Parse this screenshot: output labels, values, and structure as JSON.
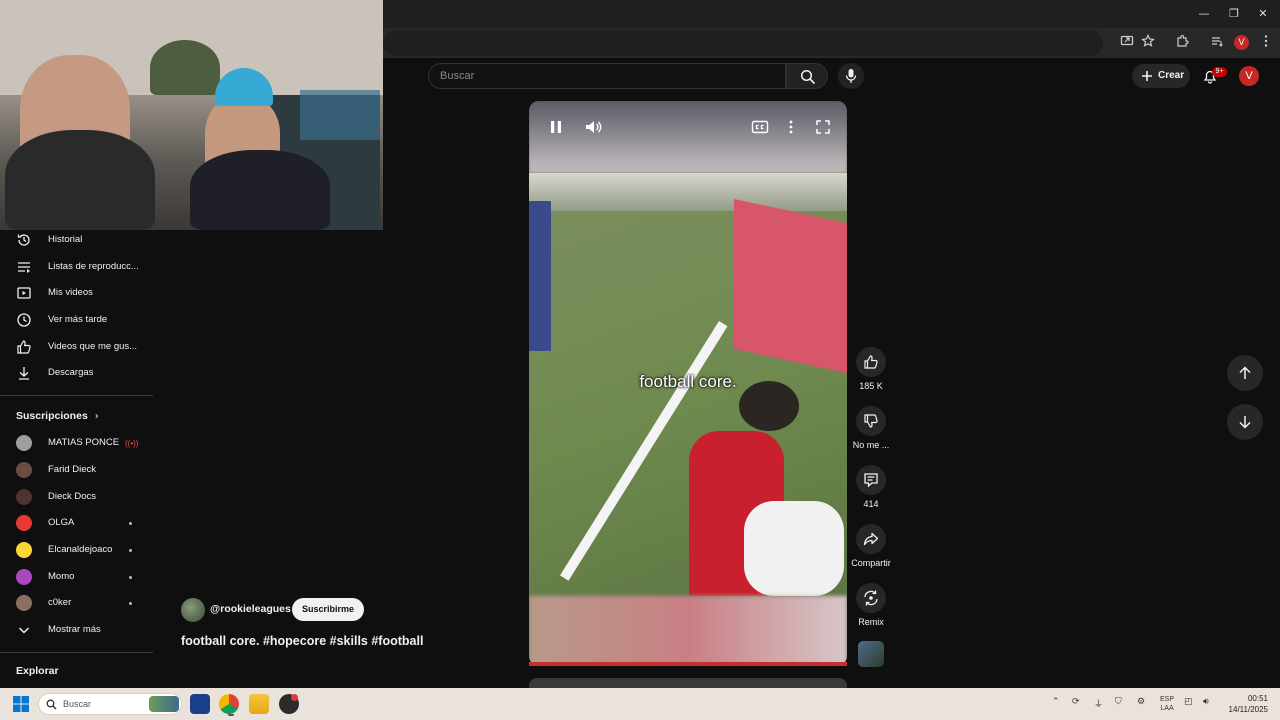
{
  "browser": {
    "window_controls": {
      "minimize": "—",
      "restore": "❐",
      "close": "✕"
    },
    "profile_initial": "V"
  },
  "header": {
    "search_placeholder": "Buscar",
    "create_label": "Crear",
    "notification_count": "9+",
    "avatar_initial": "V"
  },
  "sidebar": {
    "you_items": [
      {
        "label": "Historial",
        "icon": "history-icon"
      },
      {
        "label": "Listas de reproducc...",
        "icon": "playlist-icon"
      },
      {
        "label": "Mis videos",
        "icon": "my-videos-icon"
      },
      {
        "label": "Ver más tarde",
        "icon": "watch-later-icon"
      },
      {
        "label": "Videos que me gus...",
        "icon": "like-icon"
      },
      {
        "label": "Descargas",
        "icon": "download-icon"
      }
    ],
    "subscriptions_title": "Suscripciones",
    "subscriptions": [
      {
        "name": "MATIAS PONCE",
        "status": "live",
        "color": "#9e9e9e"
      },
      {
        "name": "Farid Dieck",
        "status": "",
        "color": "#6d4c41"
      },
      {
        "name": "Dieck Docs",
        "status": "",
        "color": "#4e342e"
      },
      {
        "name": "OLGA",
        "status": "new",
        "color": "#e53935"
      },
      {
        "name": "Elcanaldejoaco",
        "status": "new",
        "color": "#fdd835"
      },
      {
        "name": "Momo",
        "status": "new",
        "color": "#ab47bc"
      },
      {
        "name": "c0ker",
        "status": "new",
        "color": "#8d6e63"
      }
    ],
    "show_more": "Mostrar más",
    "explore_title": "Explorar"
  },
  "video": {
    "caption": "football core.",
    "channel": "@rookieleagues",
    "subscribe_label": "Suscribirme",
    "title": "football core. #hopecore #skills #football",
    "progress": 1.0
  },
  "actions": {
    "likes": "185 K",
    "dislike": "No me ...",
    "comments": "414",
    "share": "Compartir",
    "remix": "Remix"
  },
  "taskbar": {
    "search_placeholder": "Buscar",
    "lang_top": "ESP",
    "lang_bottom": "LAA",
    "time": "00:51",
    "date": "14/11/2025"
  }
}
